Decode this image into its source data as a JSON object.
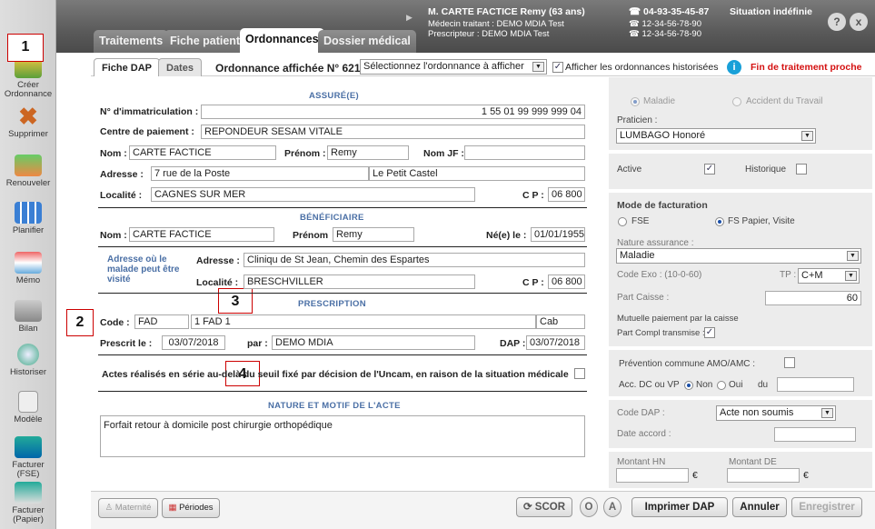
{
  "header": {
    "tabs": [
      "Traitements",
      "Fiche patient",
      "Ordonnances",
      "Dossier médical"
    ],
    "patient": "M. CARTE FACTICE Remy (63 ans)",
    "medecin": "Médecin traitant : DEMO MDIA Test",
    "prescripteur": "Prescripteur :    DEMO MDIA Test",
    "phone1": "04-93-35-45-87",
    "phone2": "12-34-56-78-90",
    "phone3": "12-34-56-78-90",
    "situation": "Situation indéfinie",
    "help": "?",
    "close": "x"
  },
  "sidebar": [
    "Créer Ordonnance",
    "Supprimer",
    "Renouveler",
    "Planifier",
    "Mémo",
    "Bilan",
    "Historiser",
    "Modèle",
    "Facturer (FSE)",
    "Facturer (Papier)"
  ],
  "callouts": [
    "1",
    "2",
    "3",
    "4"
  ],
  "subtabs": [
    "Fiche DAP",
    "Dates"
  ],
  "ordonnance_label": "Ordonnance affichée N° 621",
  "select_placeholder": "Sélectionnez l'ordonnance à afficher",
  "show_hist": "Afficher les ordonnances historisées",
  "fin_traitement": "Fin de traitement proche",
  "assure": {
    "title": "ASSURÉ(E)",
    "immat_label": "N° d'immatriculation :",
    "immat": "1 55 01 99 999 999 04",
    "centre_label": "Centre de paiement :",
    "centre": "REPONDEUR SESAM VITALE",
    "nom_label": "Nom :",
    "nom": "CARTE FACTICE",
    "prenom_label": "Prénom :",
    "prenom": "Remy",
    "nomjf_label": "Nom JF :",
    "adresse_label": "Adresse :",
    "adresse": "7 rue de la Poste",
    "adresse2": "Le Petit Castel",
    "localite_label": "Localité :",
    "localite": "CAGNES SUR MER",
    "cp_label": "C P :",
    "cp": "06 800"
  },
  "beneficiaire": {
    "title": "BÉNÉFICIAIRE",
    "nom_label": "Nom :",
    "nom": "CARTE FACTICE",
    "prenom_label": "Prénom",
    "prenom": "Remy",
    "ne_label": "Né(e) le :",
    "ne": "01/01/1955",
    "visite_label": "Adresse où le malade peut être visité",
    "adresse_label": "Adresse :",
    "adresse": "Cliniqu de St Jean, Chemin des Espartes",
    "localite_label": "Localité :",
    "localite": "BRESCHVILLER",
    "cp_label": "C P :",
    "cp": "06 800"
  },
  "prescription": {
    "title": "PRESCRIPTION",
    "code_label": "Code :",
    "code": "FAD",
    "code2": "1 FAD 1",
    "cab": "Cab",
    "prescrit_label": "Prescrit le :",
    "prescrit": "03/07/2018",
    "par_label": "par :",
    "par": "DEMO MDIA",
    "dap_label": "DAP :",
    "dap": "03/07/2018",
    "actes": "Actes réalisés en série au-delà du seuil fixé par décision de l'Uncam, en raison de la situation médicale"
  },
  "nature": {
    "title": "NATURE ET MOTIF DE L'ACTE",
    "text": "Forfait retour à domicile post chirurgie orthopédique"
  },
  "right": {
    "maladie": "Maladie",
    "accident": "Accident du Travail",
    "praticien_label": "Praticien :",
    "praticien": "LUMBAGO Honoré",
    "active": "Active",
    "historique": "Historique",
    "mode_label": "Mode de facturation",
    "fse": "FSE",
    "fs_papier": "FS Papier, Visite",
    "nature_label": "Nature assurance :",
    "nature": "Maladie",
    "code_exo": "Code Exo :  (10-0-60)",
    "tp_label": "TP :",
    "tp": "C+M",
    "part_caisse_label": "Part Caisse :",
    "part_caisse": "60",
    "mutuelle": "Mutuelle paiement par la caisse",
    "part_compl": "Part Compl transmise :",
    "prevention": "Prévention commune AMO/AMC :",
    "acc_label": "Acc. DC ou VP",
    "non": "Non",
    "oui": "Oui",
    "du": "du",
    "code_dap_label": "Code DAP :",
    "code_dap": "Acte non soumis",
    "date_accord": "Date accord :",
    "montant_hn": "Montant HN",
    "montant_de": "Montant DE",
    "euro": "€"
  },
  "bottom": {
    "maternite": "Maternité",
    "periodes": "Périodes",
    "scor": "SCOR",
    "o": "O",
    "a": "A",
    "imprimer": "Imprimer DAP",
    "annuler": "Annuler",
    "enregistrer": "Enregistrer"
  }
}
